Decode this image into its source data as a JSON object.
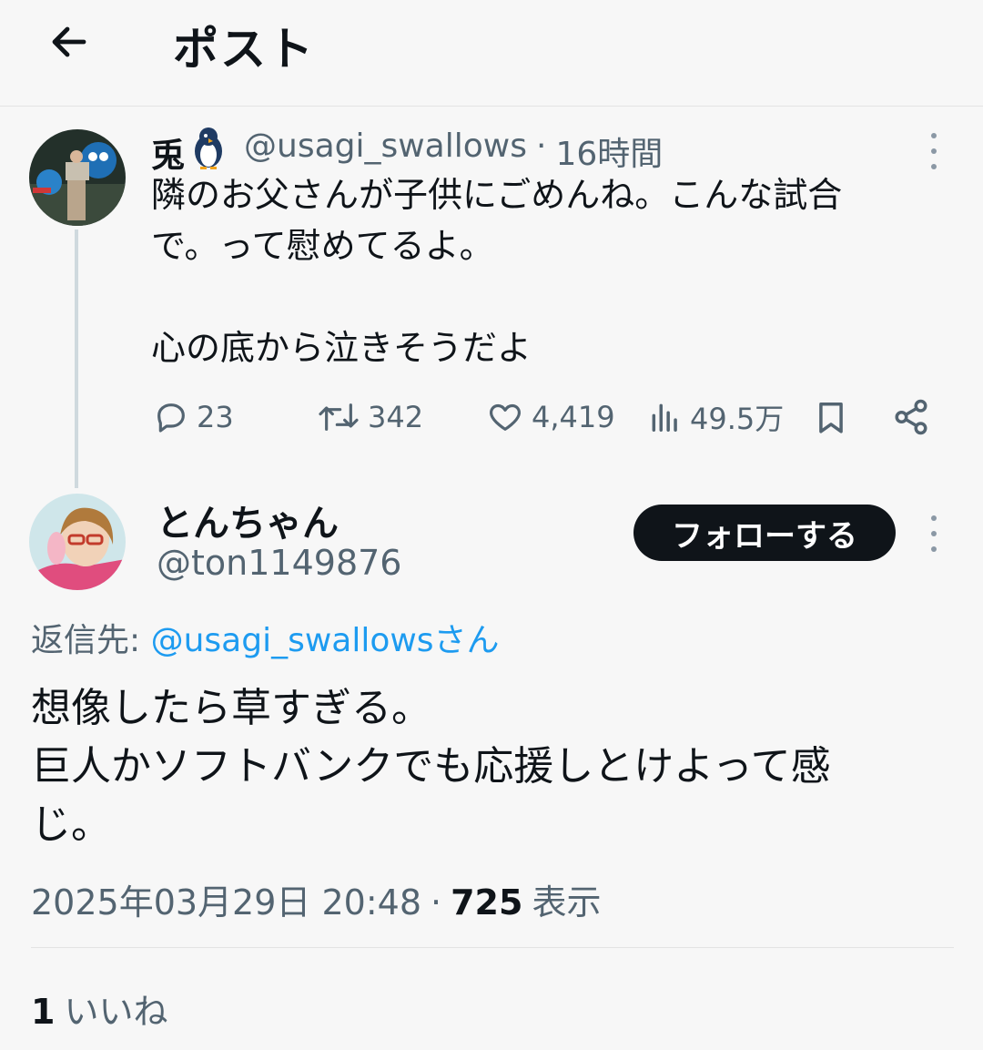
{
  "header": {
    "title": "ポスト"
  },
  "parent_tweet": {
    "display_name": "兎",
    "handle": "@usagi_swallows",
    "separator": "·",
    "time": "16時間",
    "text": "隣のお父さんが子供にごめんね。こんな試合\nで。って慰めてるよ。\n\n心の底から泣きそうだよ",
    "actions": {
      "replies": "23",
      "retweets": "342",
      "likes": "4,419",
      "views": "49.5万"
    }
  },
  "reply_tweet": {
    "display_name": "とんちゃん",
    "handle": "@ton1149876",
    "follow_label": "フォローする",
    "reply_prefix": "返信先: ",
    "reply_to": "@usagi_swallowsさん",
    "text": "想像したら草すぎる。\n巨人かソフトバンクでも応援しとけよって感\nじ。",
    "timestamp": "2025年03月29日 20:48",
    "separator": "·",
    "view_count": "725",
    "view_label": "表示"
  },
  "footer": {
    "likes_count": "1",
    "likes_label": "いいね"
  },
  "colors": {
    "accent": "#1d9bf0",
    "muted": "#536471",
    "text": "#0f1419",
    "background": "#f7f7f7"
  }
}
